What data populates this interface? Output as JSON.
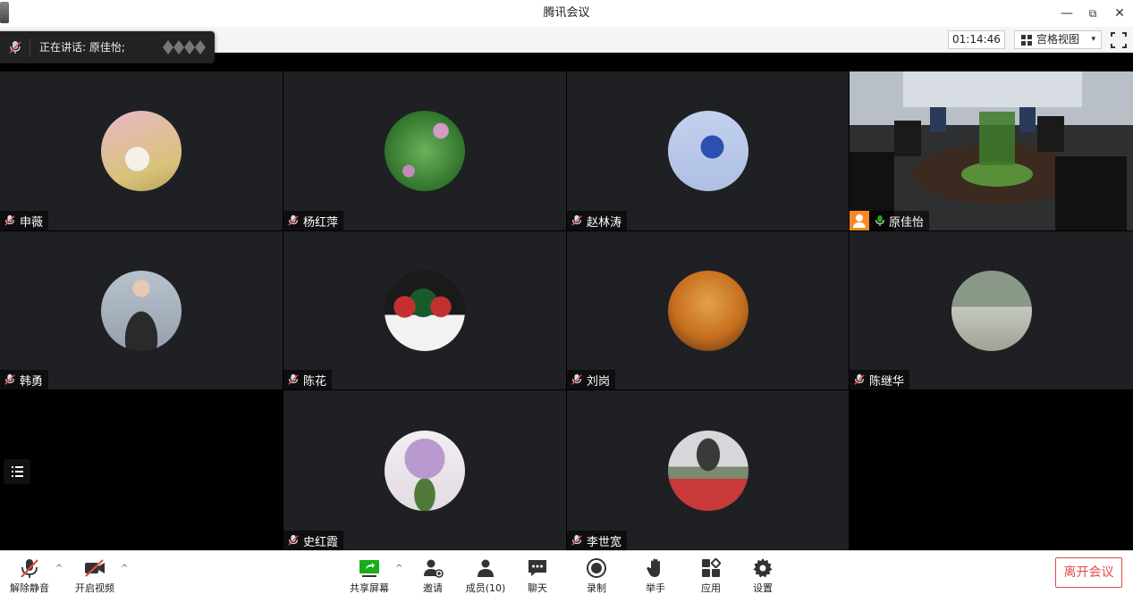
{
  "window": {
    "title": "腾讯会议",
    "minimize": "—",
    "restore": "⧉",
    "close": "✕"
  },
  "header": {
    "timer": "01:14:46",
    "view_label": "宫格视图",
    "view_caret": "▾"
  },
  "speaking": {
    "label": "正在讲话: 原佳怡;"
  },
  "participants": [
    {
      "name": "申薇",
      "avatar_colors": [
        "#e9b8c8",
        "#d9c27a"
      ]
    },
    {
      "name": "杨红萍",
      "avatar_colors": [
        "#3f8f3a",
        "#c48ab9"
      ]
    },
    {
      "name": "赵林涛",
      "avatar_colors": [
        "#aebfe3",
        "#2c4fb0"
      ]
    },
    {
      "name": "原佳怡",
      "video": true
    },
    {
      "name": "韩勇",
      "avatar_colors": [
        "#aeb8c4",
        "#3b3b3b"
      ]
    },
    {
      "name": "陈花",
      "avatar_colors": [
        "#1a5a2a",
        "#c23030"
      ]
    },
    {
      "name": "刘岗",
      "avatar_colors": [
        "#d98a2a",
        "#6b3a1a"
      ]
    },
    {
      "name": "陈继华",
      "avatar_colors": [
        "#a7b0a3",
        "#5d6b4b"
      ]
    },
    {
      "name": "史红霞",
      "avatar_colors": [
        "#e8e2ea",
        "#9b76b8"
      ]
    },
    {
      "name": "李世宽",
      "avatar_colors": [
        "#c9c9cf",
        "#c83a3a"
      ]
    }
  ],
  "toolbar": {
    "unmute": "解除静音",
    "start_video": "开启视频",
    "share_screen": "共享屏幕",
    "invite": "邀请",
    "members": "成员(10)",
    "chat": "聊天",
    "record": "录制",
    "raise_hand": "举手",
    "apps": "应用",
    "settings": "设置",
    "leave": "离开会议",
    "caret": "^"
  },
  "colors": {
    "accent_green": "#1aad19",
    "leave_red": "#e04b4b",
    "tile_bg": "#1f2024",
    "host_badge": "#f6891f"
  }
}
